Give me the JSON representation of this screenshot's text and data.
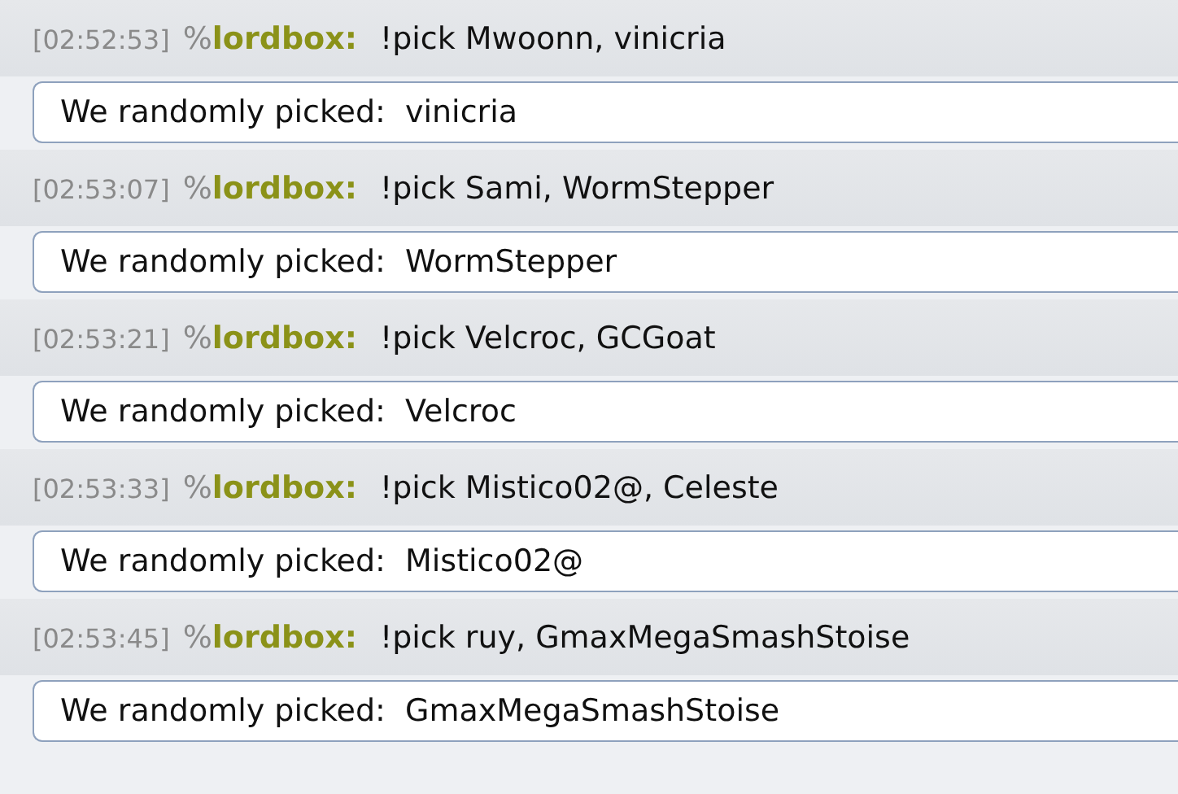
{
  "messages": [
    {
      "time": "[02:52:53]",
      "rank": "%",
      "user": "lordbox:",
      "text": "!pick Mwoonn, vinicria",
      "result": "We randomly picked:  vinicria"
    },
    {
      "time": "[02:53:07]",
      "rank": "%",
      "user": "lordbox:",
      "text": "!pick Sami, WormStepper",
      "result": "We randomly picked:  WormStepper"
    },
    {
      "time": "[02:53:21]",
      "rank": "%",
      "user": "lordbox:",
      "text": "!pick Velcroc, GCGoat",
      "result": "We randomly picked:  Velcroc"
    },
    {
      "time": "[02:53:33]",
      "rank": "%",
      "user": "lordbox:",
      "text": "!pick Mistico02@, Celeste",
      "result": "We randomly picked:  Mistico02@"
    },
    {
      "time": "[02:53:45]",
      "rank": "%",
      "user": "lordbox:",
      "text": "!pick ruy, GmaxMegaSmashStoise",
      "result": "We randomly picked:  GmaxMegaSmashStoise"
    }
  ]
}
